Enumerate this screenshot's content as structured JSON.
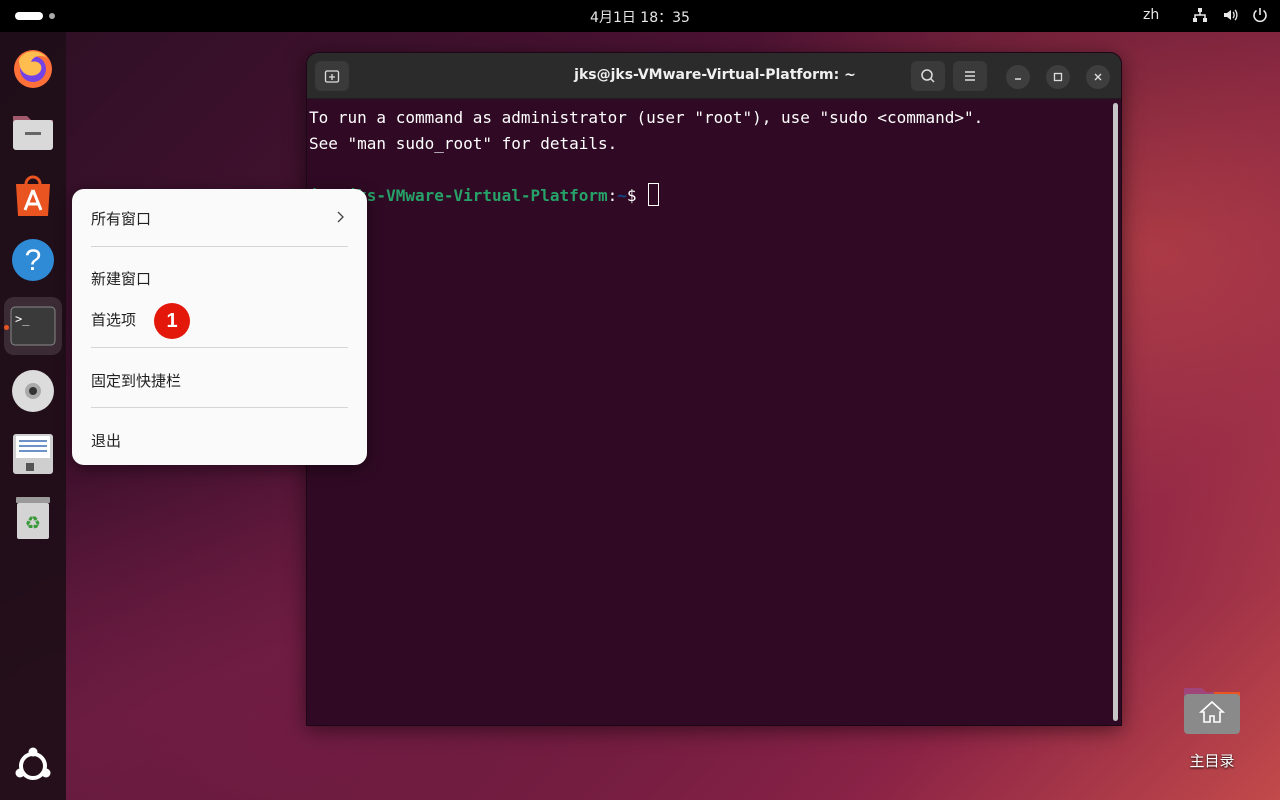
{
  "topbar": {
    "clock": "4月1日  18：35",
    "language": "zh",
    "icons": [
      "network-icon",
      "volume-icon",
      "power-icon"
    ]
  },
  "dock": {
    "items": [
      {
        "name": "firefox",
        "icon": "firefox-icon"
      },
      {
        "name": "files",
        "icon": "files-icon"
      },
      {
        "name": "app-center",
        "icon": "app-center-icon"
      },
      {
        "name": "help",
        "icon": "help-icon"
      },
      {
        "name": "terminal",
        "icon": "terminal-icon",
        "active": true
      },
      {
        "name": "disc",
        "icon": "disc-icon"
      },
      {
        "name": "text-editor",
        "icon": "text-editor-icon"
      },
      {
        "name": "trash",
        "icon": "trash-icon"
      },
      {
        "name": "show-apps",
        "icon": "ubuntu-logo-icon"
      }
    ],
    "accent": "#e95420"
  },
  "terminal": {
    "title": "jks@jks-VMware-Virtual-Platform: ~",
    "line1": "To run a command as administrator (user \"root\"), use \"sudo <command>\".",
    "line2": "See \"man sudo_root\" for details.",
    "prompt_user": "jks@jks-VMware-Virtual-Platform",
    "prompt_sep": ":",
    "prompt_path": "~",
    "prompt_symbol": "$ ",
    "background": "#300a24"
  },
  "context_menu": {
    "all_windows": "所有窗口",
    "new_window": "新建窗口",
    "preferences": "首选项",
    "pin_to_dash": "固定到快捷栏",
    "quit": "退出",
    "badge": "1"
  },
  "desktop": {
    "home_label": "主目录"
  }
}
